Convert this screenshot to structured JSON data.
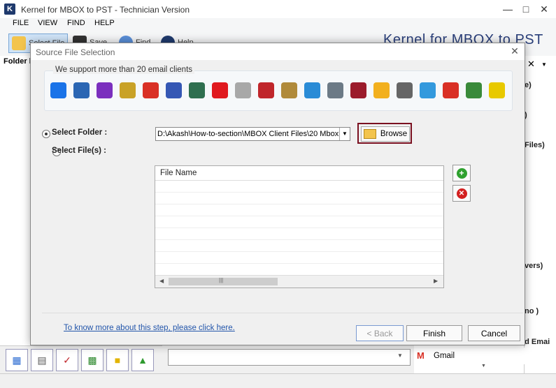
{
  "app": {
    "title": "Kernel for MBOX to PST - Technician Version",
    "icon_letter": "K",
    "brand": "Kernel for MBOX to PST"
  },
  "menu": [
    "FILE",
    "VIEW",
    "FIND",
    "HELP"
  ],
  "toolbar": {
    "select_file": "Select File",
    "save": "Save",
    "find": "Find",
    "help": "Help"
  },
  "left_panel": {
    "header": "Folder l"
  },
  "right_panel": {
    "fragments": [
      "e)",
      ")",
      "Files)",
      "vers)",
      "no )",
      "ed Emai"
    ]
  },
  "gmail": {
    "label": "Gmail"
  },
  "dialog": {
    "title": "Source File Selection",
    "support_label": "We support more than 20 email clients",
    "clients": [
      {
        "name": "mail-icon",
        "color": "#1a73e8"
      },
      {
        "name": "thunderbird-icon",
        "color": "#2b66b3"
      },
      {
        "name": "eudora-icon",
        "color": "#7b2fbe"
      },
      {
        "name": "netscape-icon",
        "color": "#c9a227"
      },
      {
        "name": "gmail-icon",
        "color": "#d93025"
      },
      {
        "name": "pegasus-icon",
        "color": "#3557b4"
      },
      {
        "name": "seamonkey-icon",
        "color": "#2f6f4f"
      },
      {
        "name": "opera-icon",
        "color": "#e0191e"
      },
      {
        "name": "mailcopa-icon",
        "color": "#a8a8a8"
      },
      {
        "name": "powermail-icon",
        "color": "#c0262b"
      },
      {
        "name": "spicebird-icon",
        "color": "#b08a3a"
      },
      {
        "name": "apple-mail-icon",
        "color": "#2a8bd6"
      },
      {
        "name": "entourage-icon",
        "color": "#6c7a86"
      },
      {
        "name": "cyrus-icon",
        "color": "#9b1b2b"
      },
      {
        "name": "gnumail-icon",
        "color": "#f2b01e"
      },
      {
        "name": "claws-mail-icon",
        "color": "#666666"
      },
      {
        "name": "sylpheed-icon",
        "color": "#3399dd"
      },
      {
        "name": "evolution-icon",
        "color": "#d93025"
      },
      {
        "name": "mutt-icon",
        "color": "#3a8a3a"
      },
      {
        "name": "thebat-icon",
        "color": "#e8c900"
      }
    ],
    "select_folder_label": "Select Folder :",
    "select_files_label": "Select File(s) :",
    "folder_path": "D:\\Akash\\How-to-section\\MBOX Client Files\\20 Mbox",
    "browse_label": "Browse",
    "file_list": {
      "header": "File Name",
      "rows": [
        "",
        "",
        "",
        "",
        "",
        "",
        "",
        ""
      ]
    },
    "more_link": "To know more about this step, please click here.",
    "back_label": "< Back",
    "finish_label": "Finish",
    "cancel_label": "Cancel"
  },
  "colors": {
    "accent": "#7a1020",
    "link": "#2255aa",
    "brand": "#2a3f7a"
  }
}
